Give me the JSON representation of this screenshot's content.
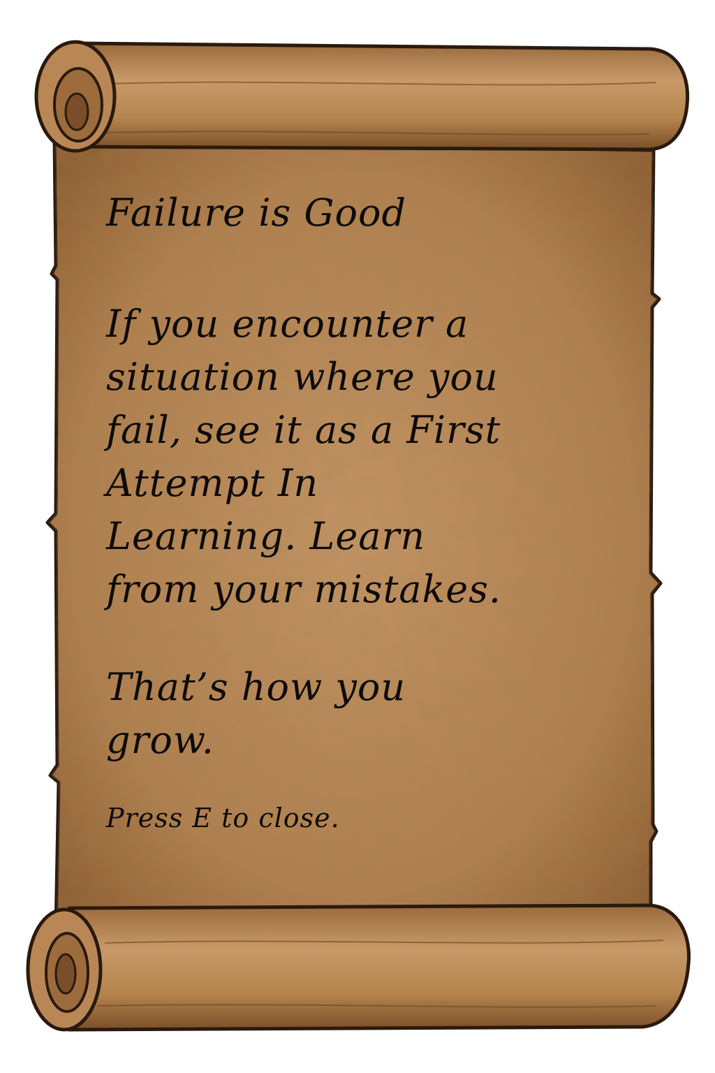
{
  "scroll": {
    "title": "Failure is Good",
    "body_lines": [
      "If you encounter a",
      "situation where you",
      "fail, see it as a First",
      "Attempt In",
      "Learning. Learn",
      "from your mistakes."
    ],
    "closing_lines": [
      "That’s how you",
      "grow."
    ],
    "hint": "Press E to close."
  },
  "colors": {
    "parchment": "#b98a58",
    "parchment_dark": "#8a5a30",
    "outline": "#2a1a0e",
    "ink": "#0d0b08"
  }
}
